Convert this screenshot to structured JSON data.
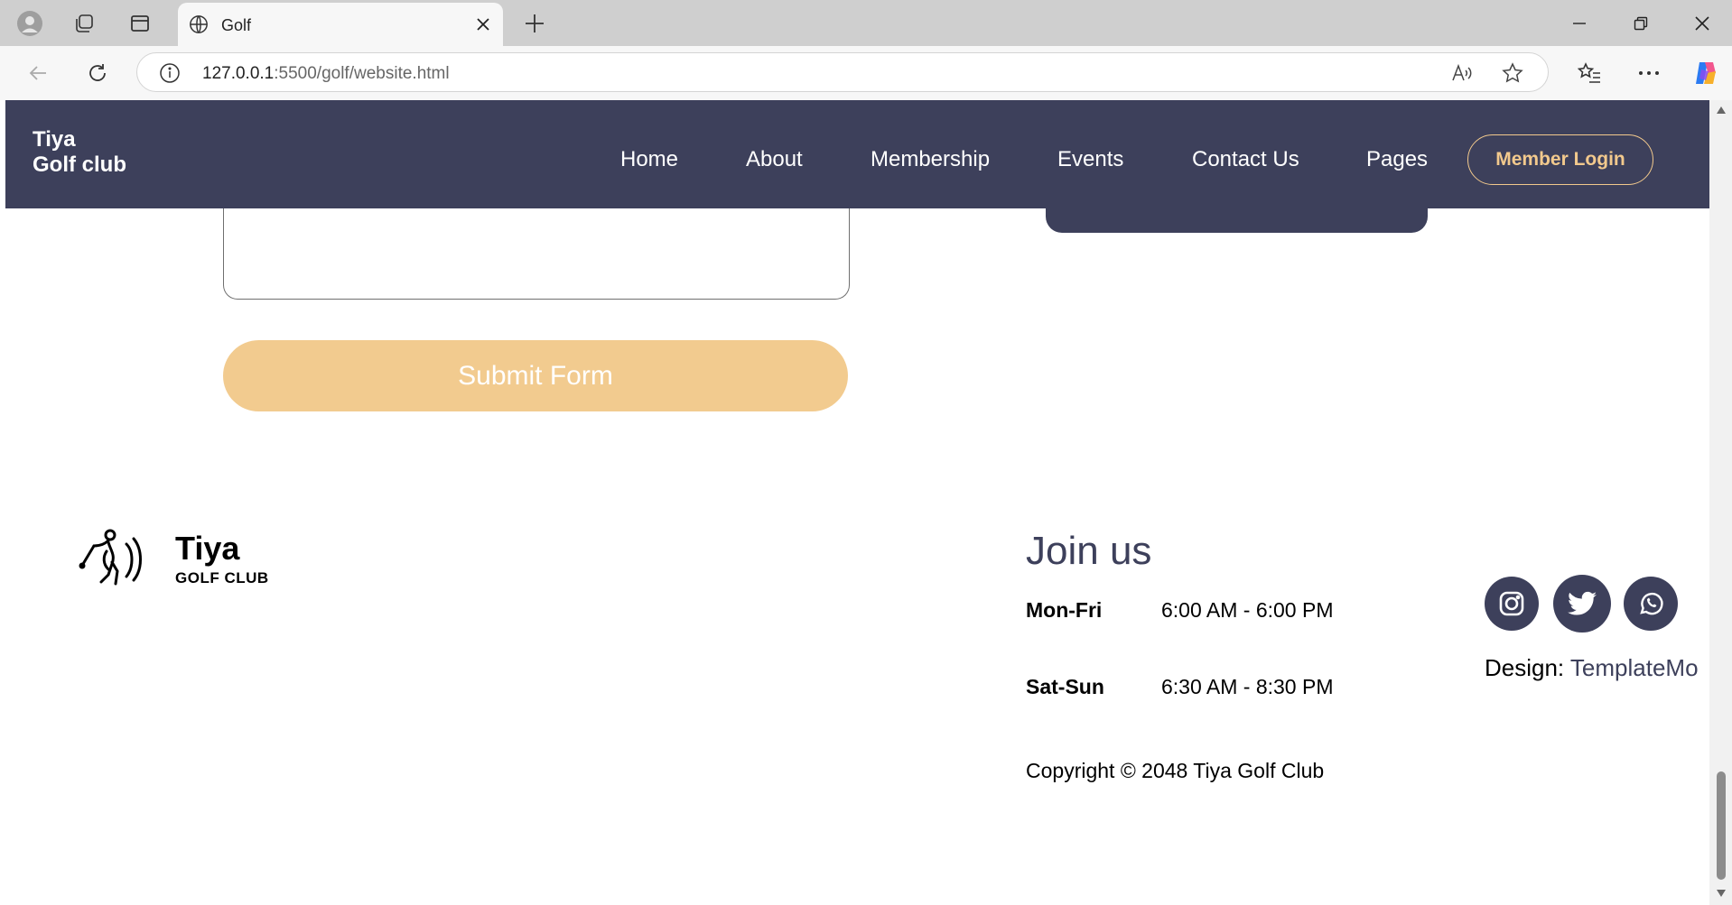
{
  "browser": {
    "tab_title": "Golf",
    "url_host": "127.0.0.1",
    "url_rest": ":5500/golf/website.html"
  },
  "nav": {
    "brand_line1": "Tiya",
    "brand_line2": "Golf club",
    "links": [
      "Home",
      "About",
      "Membership",
      "Events",
      "Contact Us",
      "Pages"
    ],
    "login": "Member Login"
  },
  "form": {
    "submit": "Submit Form"
  },
  "footer": {
    "brand_name": "Tiya",
    "brand_sub": "GOLF CLUB",
    "join_heading": "Join us",
    "hours": [
      {
        "day": "Mon-Fri",
        "time": "6:00 AM - 6:00 PM"
      },
      {
        "day": "Sat-Sun",
        "time": "6:30 AM - 8:30 PM"
      }
    ],
    "copyright": "Copyright © 2048 Tiya Golf Club",
    "design_label": "Design:",
    "design_link": "TemplateMo",
    "social": [
      "instagram-icon",
      "twitter-icon",
      "whatsapp-icon"
    ]
  },
  "colors": {
    "nav_bg": "#3d405b",
    "accent": "#f2cb8f",
    "login_border": "#f2c98d"
  }
}
